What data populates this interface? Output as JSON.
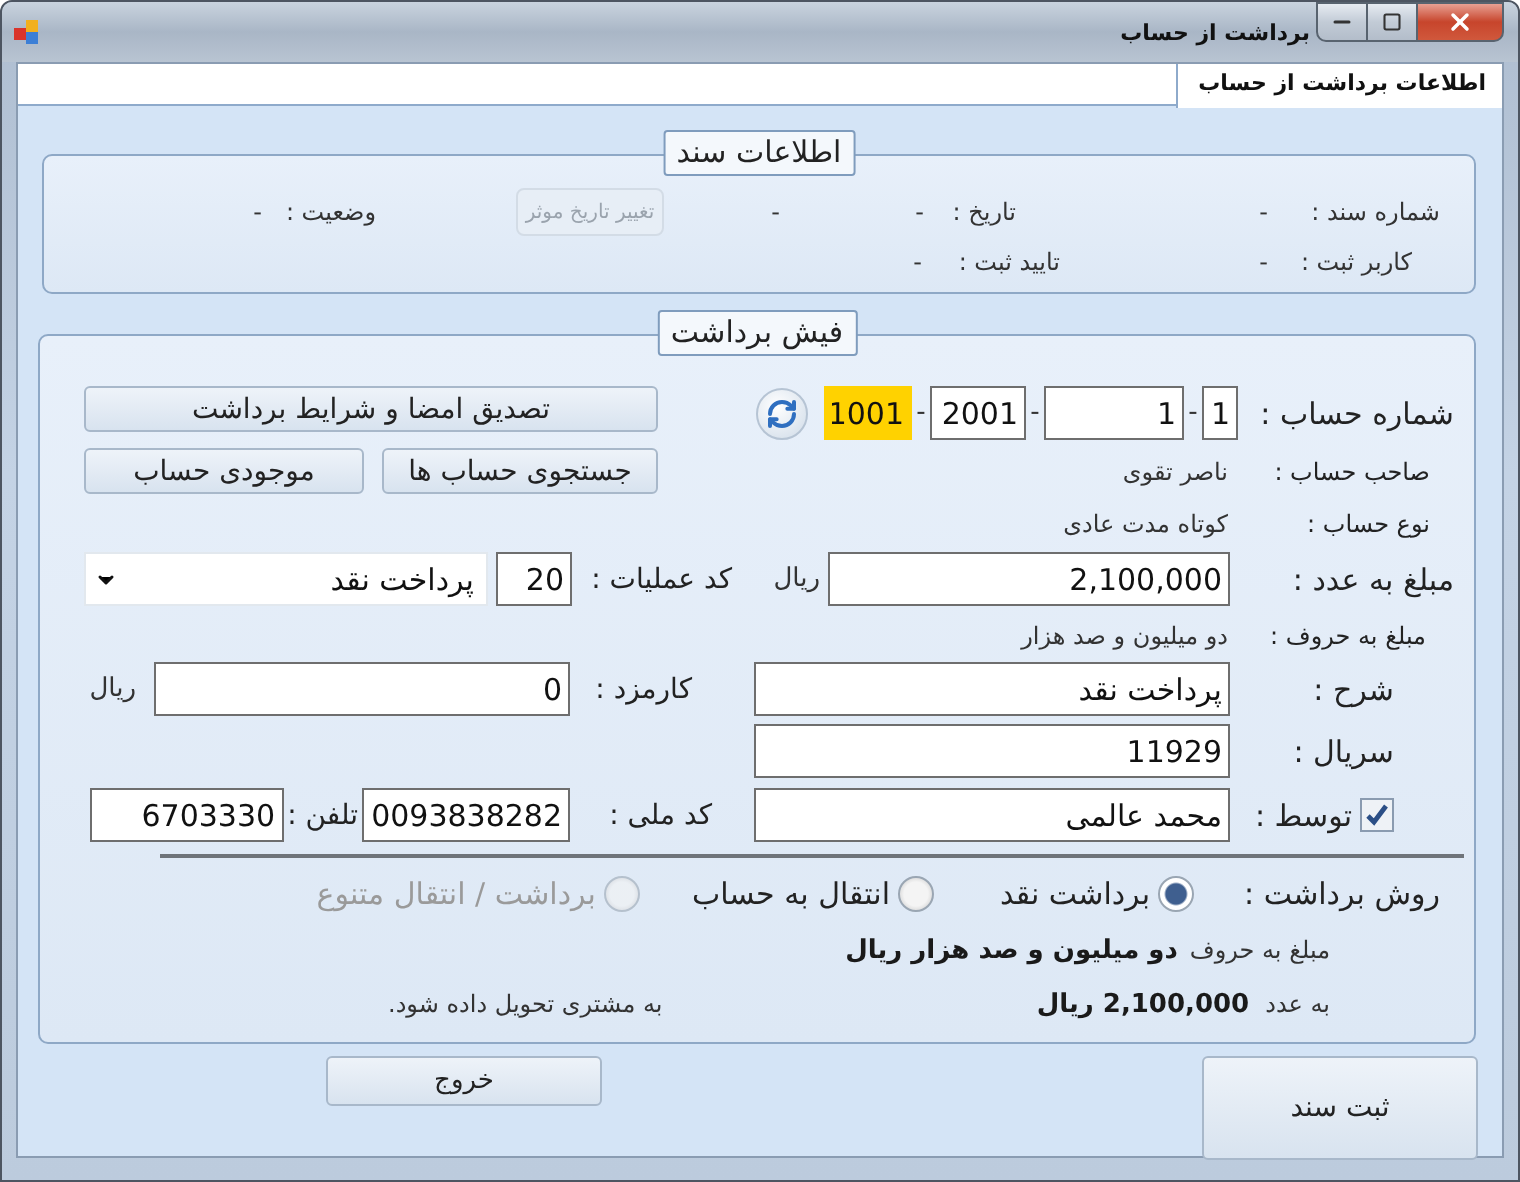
{
  "window": {
    "title": "برداشت از حساب"
  },
  "tabs": [
    {
      "label": "اطلاعات برداشت از حساب",
      "selected": true
    }
  ],
  "document_info": {
    "legend": "اطلاعات سند",
    "fields": [
      {
        "label": "شماره سند :",
        "value": "-"
      },
      {
        "label": "تاریخ :",
        "value": "-"
      },
      {
        "label": "وضعیت :",
        "value": "-"
      },
      {
        "label": "کاربر ثبت :",
        "value": "-"
      },
      {
        "label": "تایید ثبت :",
        "value": "-"
      }
    ],
    "extra_value": "-",
    "change_date_button": {
      "label": "تغییر تاریخ موثر",
      "disabled": true
    }
  },
  "receipt": {
    "legend": "فیش برداشت",
    "account_number": {
      "label": "شماره حساب :",
      "segments": [
        {
          "value": "1",
          "focused": false
        },
        {
          "value": "1",
          "focused": false
        },
        {
          "value": "2001",
          "focused": false
        },
        {
          "value": "1001",
          "focused": true
        }
      ],
      "separators": [
        "-",
        "-",
        "-"
      ]
    },
    "verify_button": "تصدیق امضا و شرایط برداشت",
    "search_button": "جستجوی حساب ها",
    "balance_button": "موجودی حساب",
    "owner": {
      "label": "صاحب حساب :",
      "value": "ناصر تقوی"
    },
    "account_type": {
      "label": "نوع حساب :",
      "value": "کوتاه مدت عادی"
    },
    "amount": {
      "label": "مبلغ به عدد :",
      "value": "2,100,000",
      "unit": "ریال"
    },
    "operation": {
      "label": "کد عملیات :",
      "code": "20",
      "selected_option": "پرداخت نقد"
    },
    "amount_words": {
      "label": "مبلغ به حروف :",
      "value": "دو میلیون و صد هزار"
    },
    "description": {
      "label": "شرح :",
      "value": "پرداخت نقد"
    },
    "fee": {
      "label": "کارمزد :",
      "value": "0",
      "unit": "ریال"
    },
    "serial": {
      "label": "سریال :",
      "value": "11929"
    },
    "agent": {
      "label": "توسط :",
      "checked": true,
      "value": "محمد عالمی"
    },
    "national_code": {
      "label": "کد ملی :",
      "value": "0093838282"
    },
    "phone": {
      "label": "تلفن :",
      "value": "6703330"
    },
    "method": {
      "label": "روش برداشت :",
      "options": [
        {
          "label": "برداشت نقد",
          "selected": true,
          "disabled": false
        },
        {
          "label": "انتقال به حساب",
          "selected": false,
          "disabled": false
        },
        {
          "label": "برداشت / انتقال متنوع",
          "selected": false,
          "disabled": true
        }
      ]
    },
    "summary_words": {
      "label": "مبلغ به حروف",
      "value": "دو میلیون و صد هزار ریال"
    },
    "summary_number": {
      "label": "به عدد",
      "value": "2,100,000 ریال"
    },
    "note": "به مشتری تحویل داده شود."
  },
  "buttons": {
    "exit": "خروج",
    "submit": "ثبت سند"
  }
}
